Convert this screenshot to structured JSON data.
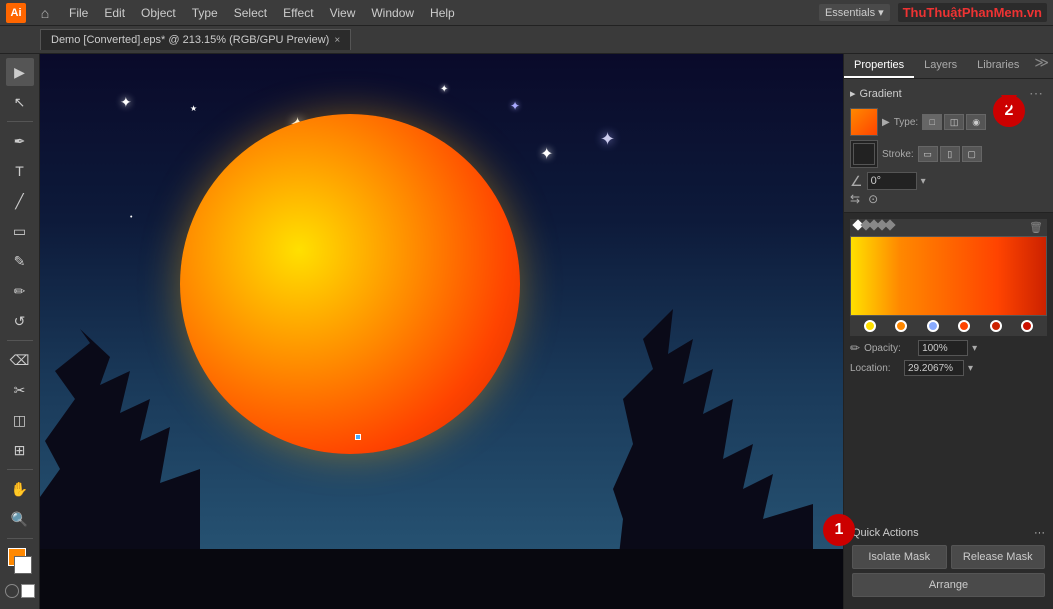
{
  "app": {
    "icon_label": "Ai",
    "watermark": "ThuThuậtPhanMem.vn"
  },
  "menu": {
    "items": [
      "File",
      "Edit",
      "Object",
      "Type",
      "Select",
      "Effect",
      "View",
      "Window",
      "Help"
    ]
  },
  "workspace": {
    "label": "Essentials"
  },
  "tab": {
    "title": "Demo [Converted].eps* @ 213.15% (RGB/GPU Preview)",
    "close_label": "×"
  },
  "panel_tabs": {
    "items": [
      "Properties",
      "Layers",
      "Libraries"
    ]
  },
  "gradient_panel": {
    "title": "Gradient",
    "type_label": "Type:",
    "stroke_label": "Stroke:",
    "angle_value": "0°",
    "type_buttons": [
      "□",
      "◫",
      "◉"
    ]
  },
  "gradient_editor": {
    "opacity_label": "Opacity:",
    "opacity_value": "100%",
    "location_label": "Location:",
    "location_value": "29.2067%"
  },
  "quick_actions": {
    "title": "Quick Actions",
    "options_label": "···",
    "buttons": {
      "isolate_mask": "Isolate Mask",
      "release_mask": "Release Mask",
      "arrange": "Arrange"
    }
  },
  "annotations": {
    "circle1": "1",
    "circle2": "2"
  },
  "tools": {
    "items": [
      "▶",
      "✎",
      "✐",
      "T",
      "◯",
      "⬜",
      "✂",
      "⬛",
      "✋",
      "🔍",
      "⚡",
      "⬡"
    ]
  }
}
